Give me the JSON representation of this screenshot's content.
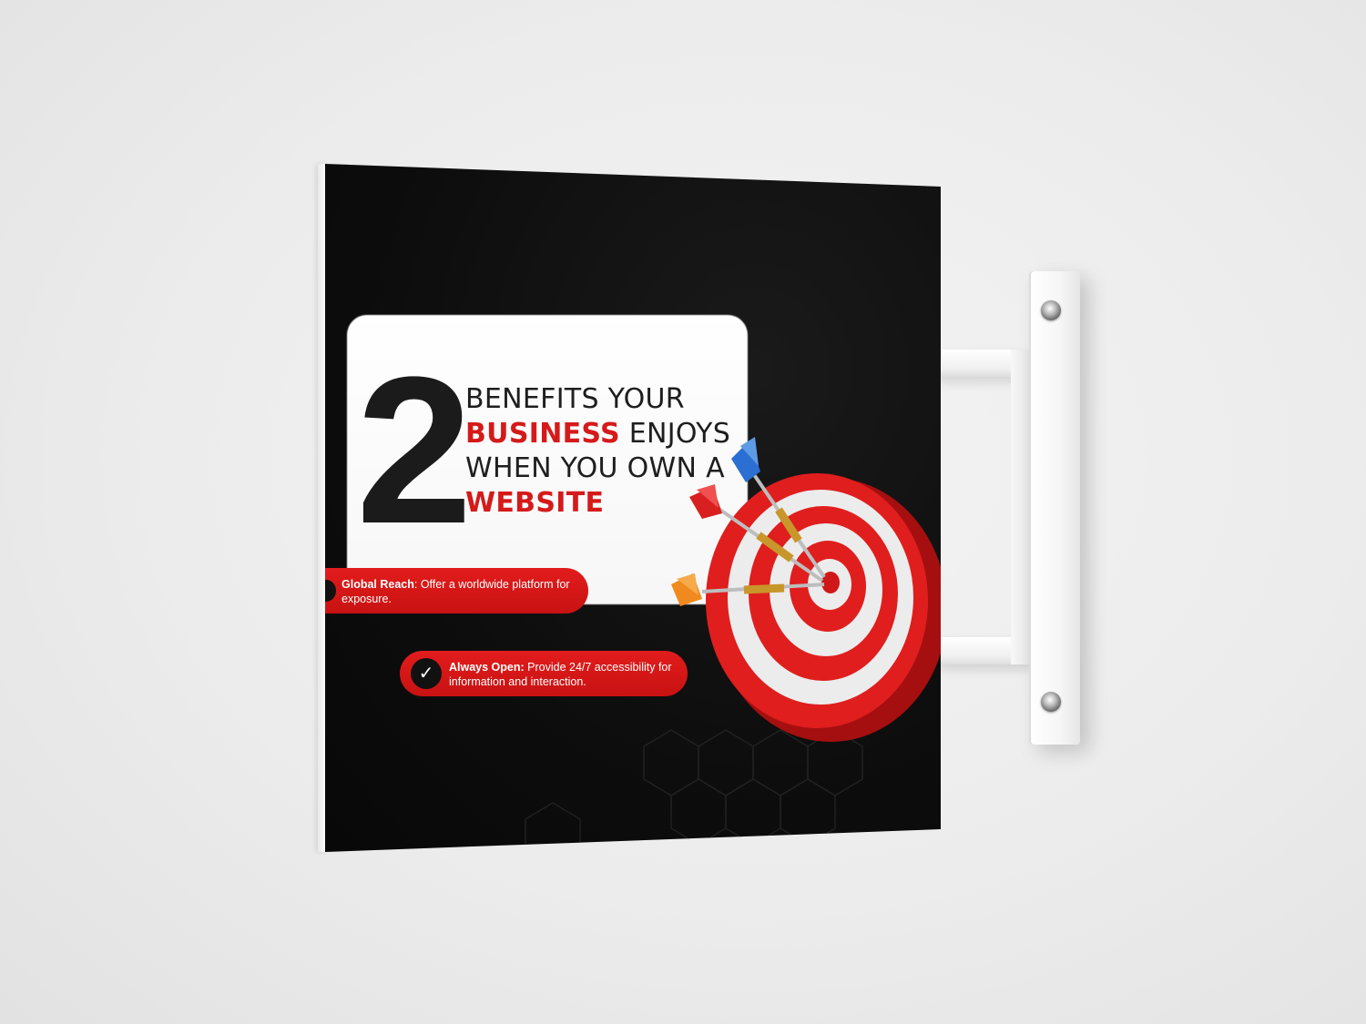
{
  "sign": {
    "number": "2",
    "headline": {
      "line1": "BENEFITS YOUR",
      "line2_highlight": "BUSINESS",
      "line2_rest": " ENJOYS",
      "line3": "WHEN YOU OWN A",
      "line4_highlight": "WEBSITE"
    },
    "benefits": [
      {
        "title": "Global Reach",
        "text": ": Offer a worldwide platform for exposure."
      },
      {
        "title": "Always Open:",
        "text": " Provide 24/7 accessibility for information and interaction."
      }
    ],
    "check_glyph": "✓"
  },
  "colors": {
    "accent_red": "#d51a1a",
    "panel_black": "#0d0d0d",
    "card_white": "#ffffff",
    "dart_blue": "#2a6fd1",
    "dart_red": "#d82020",
    "dart_orange": "#f08a1e",
    "wall": "#ececec"
  }
}
